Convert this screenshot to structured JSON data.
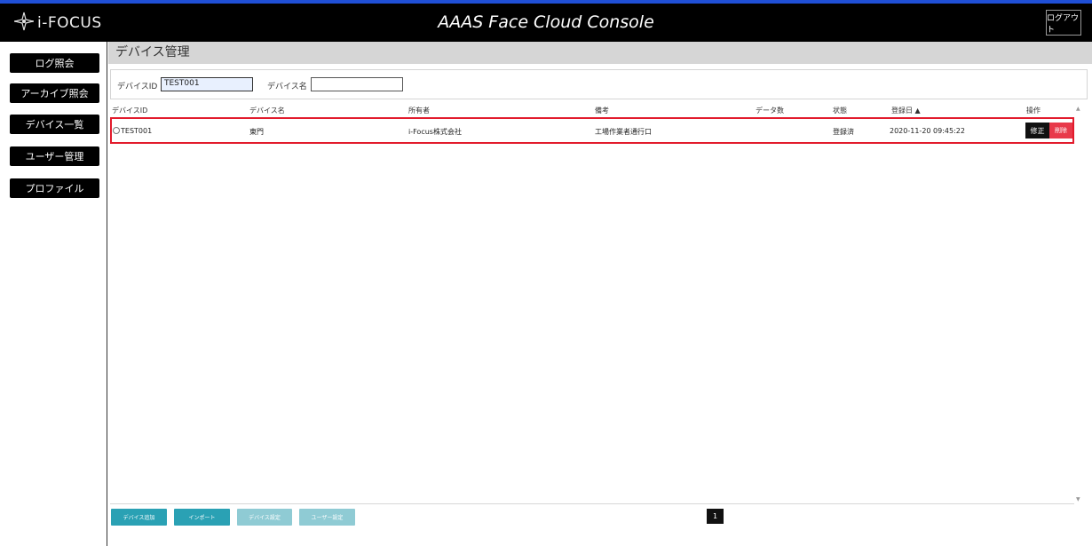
{
  "header": {
    "logo_text": "i-FOCUS",
    "app_title": "AAAS Face Cloud Console",
    "logout_label": "ログアウト"
  },
  "sidebar": {
    "items": [
      {
        "label": "ログ照会"
      },
      {
        "label": "アーカイブ照会"
      },
      {
        "label": "デバイス一覧"
      },
      {
        "label": "ユーザー管理"
      },
      {
        "label": "プロファイル"
      }
    ]
  },
  "page": {
    "title": "デバイス管理"
  },
  "filter": {
    "device_id_label": "デバイスID",
    "device_id_value": "TEST001",
    "device_name_label": "デバイス名",
    "device_name_value": ""
  },
  "table": {
    "columns": [
      "デバイスID",
      "デバイス名",
      "所有者",
      "備考",
      "データ数",
      "状態",
      "登録日 ▲",
      "操作"
    ],
    "rows": [
      {
        "device_id": "TEST001",
        "device_name": "東門",
        "owner": "i-Focus株式会社",
        "note": "工場作業者通行口",
        "data_count": "",
        "status": "登録済",
        "registered": "2020-11-20 09:45:22",
        "edit_label": "修正",
        "delete_label": "削除"
      }
    ]
  },
  "actions": {
    "add_device": "デバイス追加",
    "import": "インポート",
    "device_settings": "デバイス設定",
    "user_settings": "ユーザー設定"
  },
  "pagination": {
    "current_page": "1"
  },
  "colors": {
    "header_bg": "#000000",
    "top_accent": "#1f4fd6",
    "selected_row_border": "#e21b2c",
    "delete_button": "#e8394a",
    "action_button": "#2aa1b4"
  },
  "icons": {
    "logo_mark": "ifocus-logo-icon",
    "scroll_up": "triangle-up-icon",
    "scroll_down": "triangle-down-icon"
  }
}
